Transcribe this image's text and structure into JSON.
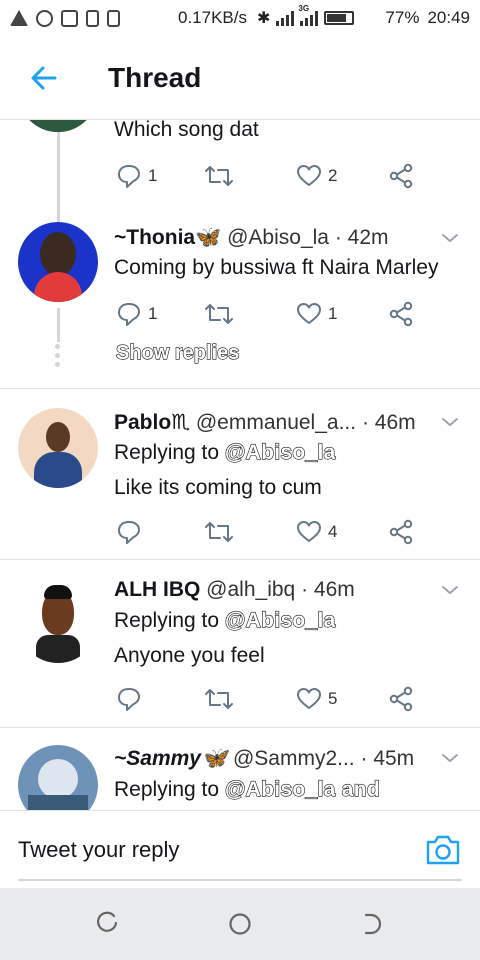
{
  "status_bar": {
    "network_speed": "0.17KB/s",
    "network_type": "3G",
    "battery": "77%",
    "time": "20:49"
  },
  "header": {
    "title": "Thread",
    "back_icon": "arrow-left-icon"
  },
  "colors": {
    "accent": "#1da1f2",
    "icon_gray": "#657786",
    "divider": "#dfe3e7",
    "navbar": "#e9ebed"
  },
  "tweets": [
    {
      "text": "Which song dat",
      "reply_count": "1",
      "like_count": "2"
    },
    {
      "name": "~Thonia🦋",
      "handle": "@Abiso_la",
      "time": "· 42m",
      "text": "Coming by bussiwa ft Naira Marley",
      "reply_count": "1",
      "like_count": "1",
      "show_replies": "Show replies"
    },
    {
      "name": "Pablo♏",
      "handle": "@emmanuel_a...",
      "time": "· 46m",
      "replying_prefix": "Replying to",
      "replying_to": "@Abiso_la",
      "text": "Like its coming to cum",
      "like_count": "4"
    },
    {
      "name": "ALH IBQ",
      "handle": "@alh_ibq",
      "time": "· 46m",
      "replying_prefix": "Replying to",
      "replying_to": "@Abiso_la",
      "text": "Anyone you feel",
      "like_count": "5"
    },
    {
      "name": "~Sammy🦋",
      "handle": "@Sammy2...",
      "time": "· 45m",
      "replying_prefix": "Replying to",
      "replying_to": "@Abiso_la and"
    }
  ],
  "composer": {
    "placeholder": "Tweet your reply"
  }
}
